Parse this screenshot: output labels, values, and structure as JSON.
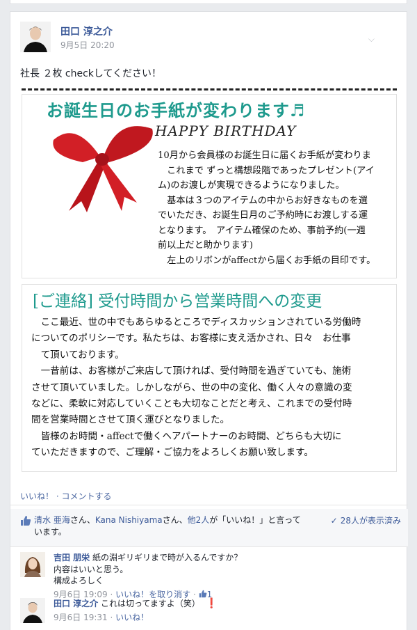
{
  "post": {
    "author": "田口 淳之介",
    "timestamp": "9月5日 20:20",
    "text": "社長 ２枚 checkしてください！",
    "actions": {
      "like": "いいね！",
      "separator": " · ",
      "comment": "コメントする"
    }
  },
  "flyer": {
    "title": "お誕生日のお手紙が変わります♬",
    "subtitle": "HAPPY BIRTHDAY",
    "body1": "10月から会員様のお誕生日に届くお手紙が変わりま\n　これまで ずっと構想段階であったプレゼント(アイ\nム)のお渡しが実現できるようになりました。\n　基本は３つのアイテムの中からお好きなものを選\nでいただき、お誕生日月のご予約時にお渡しする運\nとなります。　アイテム確保のため、事前予約(一週\n前以上だと助かります)\n　左上のリボンがaffectから届くお手紙の目印です。",
    "title2": "[ご連絡] 受付時間から営業時間への変更",
    "body2": "　ここ最近、世の中でもあらゆるところでディスカッションされている労働時\nについてのポリシーです。私たちは、お客様に支え活かされ、日々　お仕事\n　て頂いております。\n　一昔前は、お客様がご来店して頂ければ、受付時間を過ぎていても、施術\nさせて頂いていました。しかしながら、世の中の変化、働く人々の意識の変\nなどに、柔軟に対応していくことも大切なことだと考え、これまでの受付時\n間を営業時間とさせて頂く運びとなりました。\n　皆様のお時間・affectで働くヘアパートナーのお時間、どちらも大切に\nていただきますので、ご理解・ご協力をよろしくお願い致します。"
  },
  "likes": {
    "name1": "清水 亜海",
    "suffix1": "さん、",
    "name2": "Kana Nishiyama",
    "suffix2": "さん、",
    "others": "他2人",
    "rest": "が「いいね！」と言っています。",
    "views": "28人が表示済み"
  },
  "comments": [
    {
      "author": "吉田 朋栄",
      "text": "紙の淵ギリギリまで時が入るんですか？\n内容はいいと思う。\n構成よろしく",
      "time": "9月6日 19:09",
      "action": "いいね！を取り消す",
      "like_count": "1"
    },
    {
      "author": "田口 淳之介",
      "text": "これは切ってますよ（笑）",
      "alert": "❗",
      "time": "9月6日 19:31",
      "action": "いいね！"
    }
  ],
  "colors": {
    "link": "#3b5998",
    "teal": "#1e9a8d",
    "ribbon": "#d21f26"
  },
  "icons": [
    "chevron-down-icon",
    "thumbs-up-icon",
    "check-icon",
    "exclamation-icon"
  ]
}
